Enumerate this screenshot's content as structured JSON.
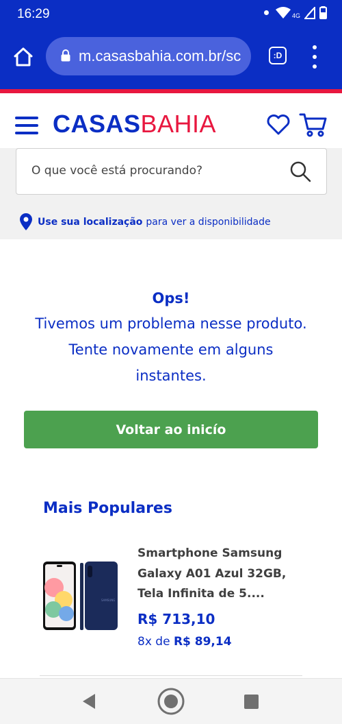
{
  "status_bar": {
    "time": "16:29",
    "network": "4G"
  },
  "browser": {
    "url": "m.casasbahia.com.br/sc",
    "tab_label": ":D"
  },
  "header": {
    "logo_part1": "CASAS",
    "logo_part2": "BAHIA",
    "search_placeholder": "O que você está procurando?",
    "location_strong": "Use sua localização",
    "location_rest": "para ver a disponibilidade"
  },
  "error": {
    "title": "Ops!",
    "message": "Tivemos um problema nesse produto. Tente novamente em alguns instantes.",
    "button_label": "Voltar ao inicío"
  },
  "popular": {
    "title": "Mais Populares",
    "products": [
      {
        "name": "Smartphone Samsung Galaxy A01 Azul 32GB, Tela Infinita de 5....",
        "price": "R$ 713,10",
        "installment_prefix": "8x de",
        "installment_value": "R$ 89,14"
      }
    ]
  },
  "colors": {
    "brand_blue": "#0b2ec4",
    "brand_red": "#e8173f",
    "button_green": "#4ca14f"
  }
}
